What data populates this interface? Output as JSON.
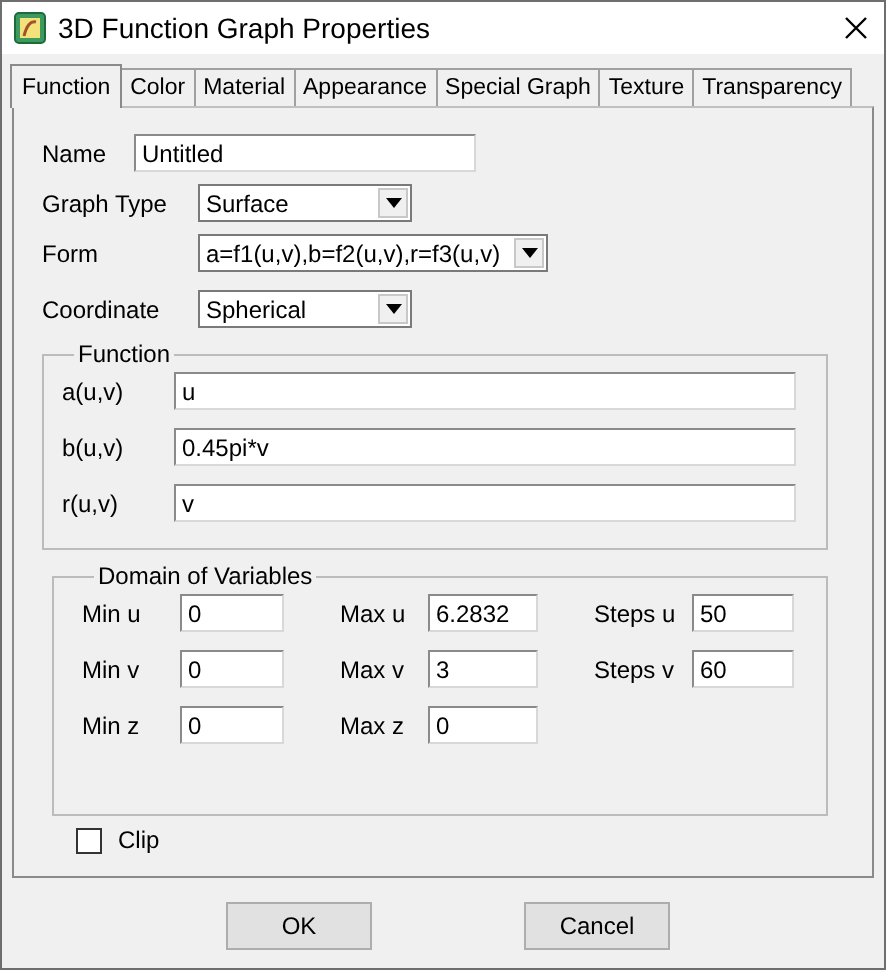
{
  "window": {
    "title": "3D Function Graph Properties"
  },
  "tabs": [
    {
      "label": "Function",
      "selected": true
    },
    {
      "label": "Color",
      "selected": false
    },
    {
      "label": "Material",
      "selected": false
    },
    {
      "label": "Appearance",
      "selected": false
    },
    {
      "label": "Special Graph",
      "selected": false
    },
    {
      "label": "Texture",
      "selected": false
    },
    {
      "label": "Transparency",
      "selected": false
    }
  ],
  "fields": [
    {
      "kind": "text",
      "label": "Name",
      "value": "Untitled"
    },
    {
      "kind": "combo",
      "label": "Graph Type",
      "value": "Surface"
    },
    {
      "kind": "combo",
      "label": "Form",
      "value": "a=f1(u,v),b=f2(u,v),r=f3(u,v)"
    },
    {
      "kind": "combo",
      "label": "Coordinate",
      "value": "Spherical"
    }
  ],
  "function_group": {
    "title": "Function",
    "rows": [
      {
        "label": "a(u,v)",
        "value": "u"
      },
      {
        "label": "b(u,v)",
        "value": "0.45pi*v"
      },
      {
        "label": "r(u,v)",
        "value": "v"
      }
    ]
  },
  "domain_group": {
    "title": "Domain of Variables",
    "rows": [
      [
        {
          "label": "Min u",
          "value": "0"
        },
        {
          "label": "Max u",
          "value": "6.2832"
        },
        {
          "label": "Steps u",
          "value": "50"
        }
      ],
      [
        {
          "label": "Min v",
          "value": "0"
        },
        {
          "label": "Max v",
          "value": "3"
        },
        {
          "label": "Steps v",
          "value": "60"
        }
      ],
      [
        {
          "label": "Min z",
          "value": "0"
        },
        {
          "label": "Max z",
          "value": "0"
        }
      ]
    ]
  },
  "clip": {
    "label": "Clip",
    "checked": false
  },
  "buttons": [
    "OK",
    "Cancel"
  ]
}
